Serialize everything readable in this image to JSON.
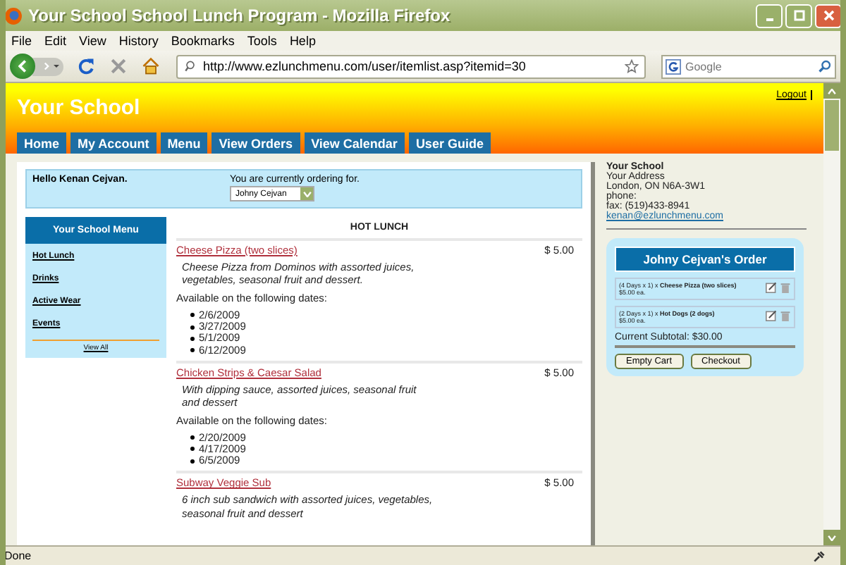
{
  "window": {
    "title": "Your School School Lunch Program - Mozilla Firefox"
  },
  "menu_bar": [
    "File",
    "Edit",
    "View",
    "History",
    "Bookmarks",
    "Tools",
    "Help"
  ],
  "toolbar": {
    "url": "http://www.ezlunchmenu.com/user/itemlist.asp?itemid=30",
    "search_placeholder": "Google"
  },
  "site": {
    "title": "Your School",
    "logout": "Logout",
    "tabs": [
      "Home",
      "My Account",
      "Menu",
      "View Orders",
      "View Calendar",
      "User Guide"
    ]
  },
  "greeting": {
    "hello": "Hello Kenan Cejvan.",
    "ordering_label": "You are currently ordering for.",
    "student": "Johny Cejvan"
  },
  "school_menu": {
    "title": "Your School Menu",
    "items": [
      "Hot Lunch",
      "Drinks",
      "Active Wear",
      "Events"
    ],
    "view_all": "View All"
  },
  "section_title": "HOT LUNCH",
  "items": [
    {
      "name": "Cheese Pizza (two slices)",
      "price": "$ 5.00",
      "description": "Cheese Pizza from Dominos with assorted juices, vegetables, seasonal fruit and dessert.",
      "dates_label": "Available on the following dates:",
      "dates": [
        "2/6/2009",
        "3/27/2009",
        "5/1/2009",
        "6/12/2009"
      ]
    },
    {
      "name": "Chicken Strips & Caesar Salad",
      "price": "$ 5.00",
      "description": "With dipping sauce, assorted juices, seasonal fruit and dessert",
      "dates_label": "Available on the following dates:",
      "dates": [
        "2/20/2009",
        "4/17/2009",
        "6/5/2009"
      ]
    },
    {
      "name": "Subway Veggie Sub",
      "price": "$ 5.00",
      "description": "6 inch sub sandwich with assorted juices, vegetables, seasonal fruit and dessert"
    }
  ],
  "school_info": {
    "name": "Your School",
    "lines": [
      "Your Address",
      "London, ON N6A-3W1",
      "phone:",
      "fax: (519)433-8941"
    ],
    "email": "kenan@ezlunchmenu.com"
  },
  "order": {
    "title": "Johny Cejvan's Order",
    "lines": [
      {
        "quantity": "(4 Days x 1) x",
        "name": "Cheese Pizza (two slices)",
        "price": "$5.00 ea."
      },
      {
        "quantity": "(2 Days x 1) x",
        "name": "Hot Dogs (2 dogs)",
        "price": "$5.00 ea."
      }
    ],
    "subtotal": "Current Subtotal: $30.00",
    "buttons": [
      "Empty Cart",
      "Checkout"
    ]
  },
  "status_bar": {
    "text": "Done"
  }
}
